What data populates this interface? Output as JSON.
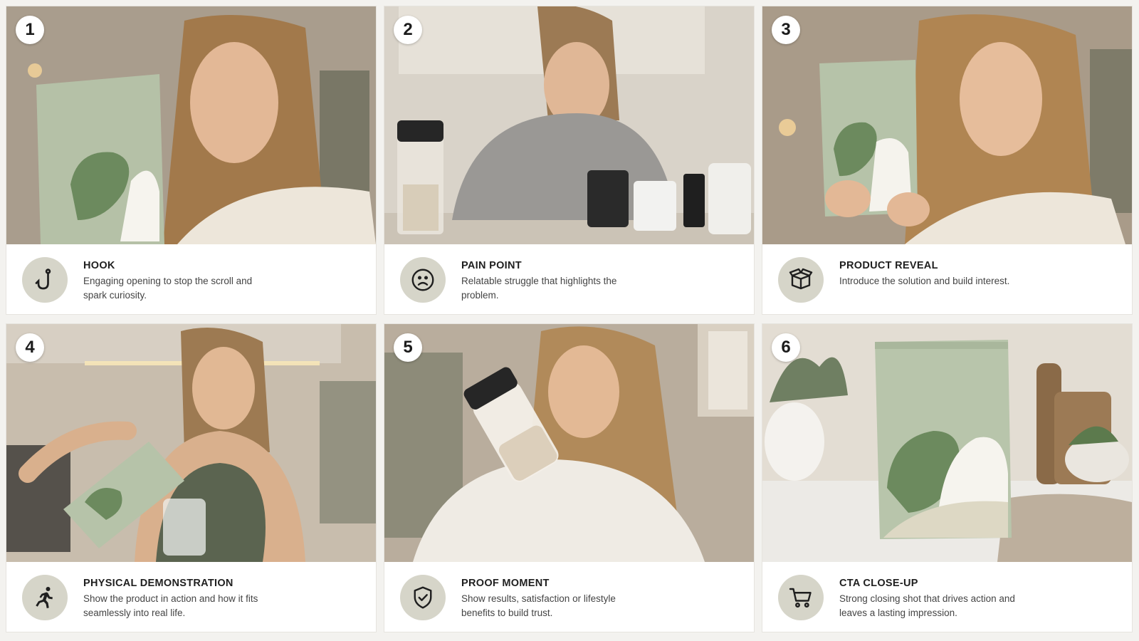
{
  "accent_color": "#d6d5c9",
  "steps": [
    {
      "number": "1",
      "title": "HOOK",
      "description": "Engaging opening to stop the scroll and spark curiosity.",
      "icon": "hook-icon"
    },
    {
      "number": "2",
      "title": "PAIN POINT",
      "description": "Relatable struggle that highlights the problem.",
      "icon": "sad-face-icon"
    },
    {
      "number": "3",
      "title": "PRODUCT REVEAL",
      "description": "Introduce the solution and build interest.",
      "icon": "box-icon"
    },
    {
      "number": "4",
      "title": "PHYSICAL DEMONSTRATION",
      "description": "Show the product in action and how it fits seamlessly into real life.",
      "icon": "running-person-icon"
    },
    {
      "number": "5",
      "title": "PROOF MOMENT",
      "description": "Show results, satisfaction or lifestyle benefits to build trust.",
      "icon": "shield-check-icon"
    },
    {
      "number": "6",
      "title": "CTA CLOSE-UP",
      "description": "Strong closing shot that drives action and leaves a lasting impression.",
      "icon": "shopping-cart-icon"
    }
  ]
}
